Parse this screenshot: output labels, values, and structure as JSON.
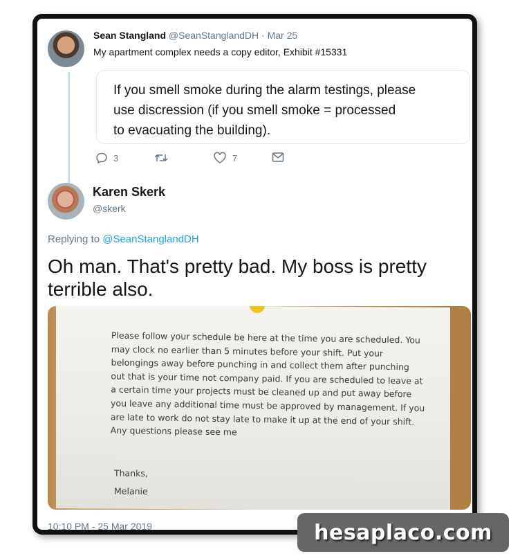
{
  "tweet1": {
    "name": "Sean Stangland",
    "handle": "@SeanStanglandDH",
    "date": "Mar 25",
    "text": "My apartment complex needs a copy editor, Exhibit #15331",
    "quote_lines": [
      "If you smell smoke during the alarm testings, please",
      "use discression (if you smell smoke = processed",
      "to evacuating the building)."
    ],
    "actions": {
      "reply_count": "3",
      "retweet_count": "",
      "like_count": "7"
    }
  },
  "tweet2": {
    "name": "Karen Skerk",
    "handle": "@skerk",
    "replying_prefix": "Replying to",
    "replying_handle": "@SeanStanglandDH",
    "text": "Oh man. That's pretty bad. My boss is pretty terrible also.",
    "photo_note_lines": [
      "Please follow your schedule be here at the time you are scheduled. You",
      "may clock no earlier than 5 minutes before your shift. Put your",
      "belongings away before punching in and collect them after punching",
      "out that is your time not company paid. If you are scheduled to leave at",
      "a certain time your projects must be cleaned up and put away before",
      "you leave any additional time must be approved by management. If you",
      "are late to work do not stay late to make it up at the end of your shift.",
      "Any questions please see me"
    ],
    "photo_signoff": "Thanks,",
    "photo_signature": "Melanie",
    "timestamp": "10:10 PM - 25 Mar 2019"
  },
  "watermark": "hesaplaco.com",
  "colors": {
    "link": "#1da1f2",
    "muted": "#657786",
    "thread": "#c4e5fb",
    "text": "#14171a"
  }
}
